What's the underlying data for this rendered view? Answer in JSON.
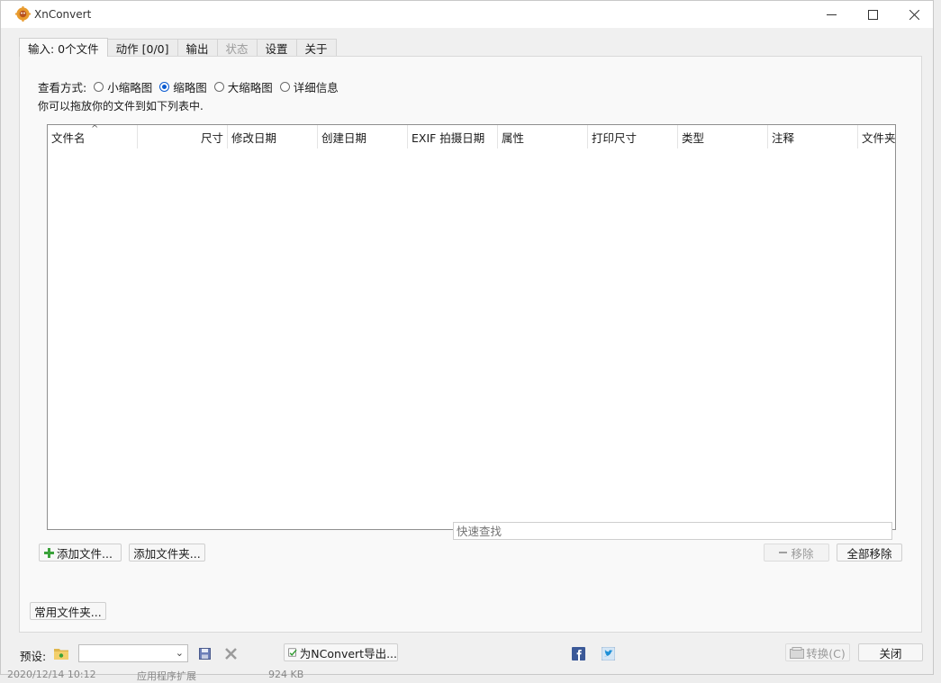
{
  "window": {
    "title": "XnConvert"
  },
  "tabs": [
    {
      "label": "输入: 0个文件"
    },
    {
      "label": "动作 [0/0]"
    },
    {
      "label": "输出"
    },
    {
      "label": "状态"
    },
    {
      "label": "设置"
    },
    {
      "label": "关于"
    }
  ],
  "view": {
    "label": "查看方式:",
    "options": [
      "小缩略图",
      "缩略图",
      "大缩略图",
      "详细信息"
    ],
    "selected": "缩略图"
  },
  "hint": "你可以拖放你的文件到如下列表中.",
  "list": {
    "columns": [
      "文件名",
      "尺寸",
      "修改日期",
      "创建日期",
      "EXIF 拍摄日期",
      "属性",
      "打印尺寸",
      "类型",
      "注释",
      "文件夹"
    ],
    "rows": []
  },
  "buttons": {
    "add_files": "添加文件...",
    "add_folder": "添加文件夹...",
    "remove": "移除",
    "remove_all": "全部移除",
    "favorites": "常用文件夹...",
    "export": "为NConvert导出...",
    "convert": "转换(C)",
    "close": "关闭"
  },
  "search": {
    "placeholder": "快速查找"
  },
  "preset": {
    "label": "预设:",
    "value": ""
  },
  "background_strip": {
    "date": "2020/12/14 10:12",
    "type": "应用程序扩展",
    "size": "924 KB"
  }
}
